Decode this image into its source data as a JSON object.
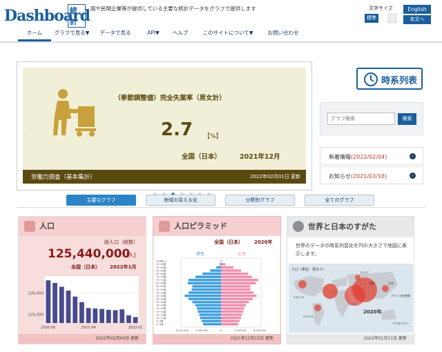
{
  "header": {
    "logo_text": "Dashboard",
    "logo_sub": "統計",
    "tagline": "国や民間企業等が提供している主要な統計データをグラフで提供します",
    "font_size_label": "文字サイズ",
    "font_standard": "標準",
    "font_large": "大",
    "english": "English",
    "japanese": "本文へ"
  },
  "nav": [
    {
      "label": "ホーム"
    },
    {
      "label": "グラフで見る▼"
    },
    {
      "label": "データで見る"
    },
    {
      "label": "API▼"
    },
    {
      "label": "ヘルプ"
    },
    {
      "label": "このサイトについて▼"
    },
    {
      "label": "お問い合わせ"
    }
  ],
  "slide": {
    "title": "（季節調整値）完全失業率（男女計）",
    "value": "2.7",
    "unit": "【%】",
    "region": "全国（日本）",
    "period": "2021年12月",
    "source": "労働力調査（基本集計）",
    "updated": "2022年02月01日 更新",
    "prev_arrow": "‹",
    "next_arrow": "›",
    "dot_count": 7,
    "active_dot": 2
  },
  "side": {
    "timeseries_label": "時系列表",
    "search_placeholder": "グラフ検索",
    "search_button": "検索",
    "news_label": "新着情報",
    "news_date": "(2022/02/04)",
    "notice_label": "お知らせ",
    "notice_date": "(2021/03/18)"
  },
  "tabs": [
    {
      "label": "主要なグラフ"
    },
    {
      "label": "地域の見える化"
    },
    {
      "label": "分野別グラフ"
    },
    {
      "label": "全てのグラフ"
    }
  ],
  "cards": {
    "population": {
      "title": "人口",
      "caption": "総人口（総数）",
      "value": "125,440,000",
      "unit": "[人]",
      "region": "全国（日本）",
      "period": "2022年1月",
      "updated": "2022年02月04日 更新"
    },
    "pyramid": {
      "title": "人口ピラミッド",
      "region": "全国（日本）",
      "year": "2020年",
      "male": "男性",
      "female": "女性",
      "updated": "2021年12月15日 更新"
    },
    "world": {
      "title": "世界と日本のすがた",
      "description": "世界のデータの時系列変化を円の大きさで地図に表示します。",
      "map_label": "人口（単位：百万人）",
      "map_year": "2020年",
      "updated": "2022年01月11日 更新"
    }
  },
  "colors": {
    "brand": "#1a5e9c",
    "slide_bg": "#f2efd8",
    "slide_dark": "#5a4a10",
    "pop_bar": "#4a4a8f",
    "male": "#3fa0dd",
    "female": "#ef8fb0",
    "bubble": "#e23b2b"
  },
  "chart_data": [
    {
      "type": "bar",
      "title": "",
      "categories": [
        "2020-06",
        "",
        "",
        "",
        "",
        "",
        "2021-04",
        "",
        "",
        "",
        "",
        "",
        "",
        "2022-01"
      ],
      "tick_labels": [
        "2020-06",
        "2021-04",
        "2022-01"
      ],
      "values": [
        126300,
        126240,
        126150,
        126060,
        125920,
        125790,
        125650,
        125640,
        125630,
        125610,
        125600,
        125620,
        125480,
        125440
      ],
      "y_ticks": [
        "126,000",
        "125,500"
      ],
      "ylim": [
        125300,
        126400
      ]
    },
    {
      "type": "bar",
      "title": "人口ピラミッド",
      "age_groups": [
        "0～4歳",
        "5～9歳",
        "10～14歳",
        "15～19歳",
        "20～24歳",
        "25～29歳",
        "30～34歳",
        "35～39歳",
        "40～44歳",
        "45～49歳",
        "50～54歳",
        "55～59歳",
        "60～64歳",
        "65～69歳",
        "70～74歳",
        "75～79歳",
        "80～84歳",
        "85～89歳",
        "90～94歳",
        "95～99歳",
        "100歳以上"
      ],
      "age_labels_shown": [
        "100歳以上",
        "95～99歳",
        "90～94歳",
        "85～89歳",
        "80～84歳",
        "75～79歳",
        "70～74歳",
        "65～69歳",
        "60～64歳",
        "55～59歳",
        "50～54歳",
        "45～49歳",
        "40～44歳",
        "35～39歳",
        "30～34歳",
        "25～29歳",
        "20～24歳",
        "15～19歳",
        "10～14歳",
        "5～9歳",
        "0～4歳"
      ],
      "series": [
        {
          "name": "男性",
          "values": [
            2.3,
            2.5,
            2.7,
            2.8,
            3.0,
            3.1,
            3.3,
            3.7,
            4.2,
            4.7,
            4.2,
            3.8,
            3.7,
            4.3,
            4.2,
            3.3,
            2.4,
            1.4,
            0.6,
            0.15,
            0.02
          ]
        },
        {
          "name": "女性",
          "values": [
            2.2,
            2.4,
            2.6,
            2.7,
            2.9,
            3.0,
            3.2,
            3.6,
            4.1,
            4.6,
            4.2,
            3.8,
            3.8,
            4.5,
            4.8,
            4.0,
            3.5,
            2.6,
            1.6,
            0.55,
            0.08
          ]
        }
      ],
      "x_ticks": [
        "6,000,000",
        "2,000,000",
        "0",
        "2,000,000",
        "6,000,000"
      ],
      "xlabel": "",
      "ylabel": ""
    }
  ],
  "map_labels": [
    "アメリカ合衆国",
    "メキシコ",
    "ブラジル",
    "アルゼンチン",
    "日本",
    "ロシア",
    "インド",
    "中国"
  ]
}
